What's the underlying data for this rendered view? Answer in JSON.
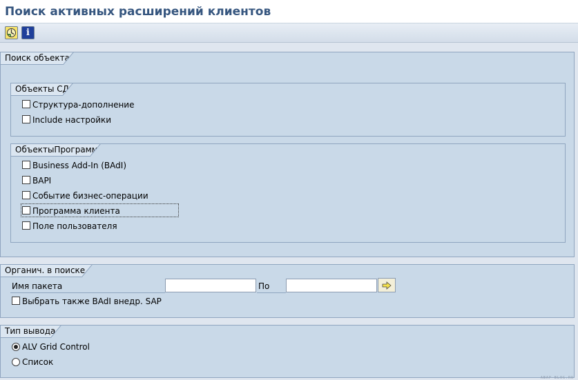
{
  "window": {
    "title": "Поиск активных расширений клиентов"
  },
  "toolbar": {
    "execute_icon": "execute-icon",
    "info_icon": "info-icon",
    "info_glyph": "i"
  },
  "search_object": {
    "title": "Поиск объекта",
    "ddic_group": {
      "title": "Объекты СД",
      "items": [
        {
          "label": "Структура-дополнение",
          "checked": false
        },
        {
          "label": "Include настройки",
          "checked": false
        }
      ]
    },
    "program_group": {
      "title": "ОбъектыПрограмм",
      "items": [
        {
          "label": "Business Add-In (BAdI)",
          "checked": false
        },
        {
          "label": "BAPI",
          "checked": false
        },
        {
          "label": "Событие бизнес-операции",
          "checked": false
        },
        {
          "label": "Программа клиента",
          "checked": false
        },
        {
          "label": "Поле пользователя",
          "checked": false
        }
      ]
    }
  },
  "restrictions": {
    "title": "Органич. в поиске",
    "package_label": "Имя пакета",
    "package_from": "",
    "to_label": "По",
    "package_to": "",
    "also_sap_badi": {
      "label": "Выбрать также BAdI внедр. SAP",
      "checked": false
    }
  },
  "output": {
    "title": "Тип вывода",
    "options": [
      {
        "label": "ALV Grid Control",
        "selected": true
      },
      {
        "label": "Список",
        "selected": false
      }
    ]
  },
  "watermark": "ABAP-BLOG.RU",
  "colors": {
    "title": "#36567f",
    "group_bg": "#c9d9e8",
    "group_border": "#8fa5bf",
    "page_bg": "#dfe6ef"
  }
}
